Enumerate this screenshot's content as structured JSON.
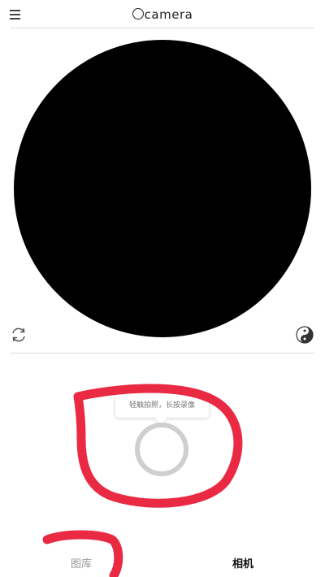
{
  "header": {
    "title": "camera",
    "menu_icon": "hamburger-menu-icon",
    "logo_icon": "circle-logo-icon"
  },
  "viewfinder": {
    "color": "#000000"
  },
  "controls": {
    "switch_icon": "refresh-icon",
    "filter_icon": "yin-yang-icon"
  },
  "tooltip": {
    "text": "轻触拍照，长按录像"
  },
  "shutter": {
    "icon": "shutter-ring-icon",
    "ring_color": "#cfcfcf"
  },
  "tabs": [
    {
      "label": "图库",
      "active": false
    },
    {
      "label": "相机",
      "active": true
    }
  ],
  "annotation": {
    "color": "#e8132f"
  }
}
